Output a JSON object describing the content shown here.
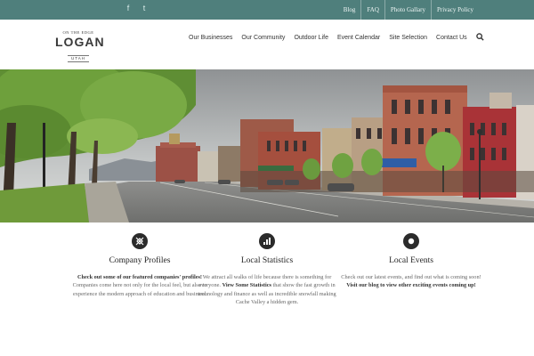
{
  "topbar": {
    "background": "#4f7f7c",
    "social": [
      {
        "icon": "facebook-icon",
        "glyph": "f"
      },
      {
        "icon": "twitter-icon",
        "glyph": "t"
      }
    ],
    "links": [
      "Blog",
      "FAQ",
      "Photo Gallary",
      "Privacy Policy"
    ]
  },
  "header": {
    "logo": {
      "tagline": "ON THE EDGE",
      "name": "LOGAN",
      "state": "UTAH"
    },
    "nav": [
      "Our Businesses",
      "Our Community",
      "Outdoor Life",
      "Event Calendar",
      "Site Selection",
      "Contact Us"
    ],
    "search_icon": "search-icon"
  },
  "hero": {
    "description_icon": "street-photo"
  },
  "features": [
    {
      "icon": "compass-icon",
      "title": "Company Profiles",
      "text_parts": [
        {
          "t": "Check out some of our featured companies' profiles!",
          "bold": true
        },
        {
          "t": " Companies come here not only for the local feel, but also to experience the modern approach of education and business.",
          "bold": false
        }
      ]
    },
    {
      "icon": "bar-chart-icon",
      "title": "Local Statistics",
      "text_parts": [
        {
          "t": "We attract all walks of life because there is something for everyone. ",
          "bold": false
        },
        {
          "t": "View Some Statistics",
          "bold": true
        },
        {
          "t": " that show the fast growth in technology and finance as well as incredible snowfall making Cache Valley a hidden gem.",
          "bold": false
        }
      ]
    },
    {
      "icon": "circle-icon",
      "title": "Local Events",
      "text_parts": [
        {
          "t": "Check out our latest events, and find out what is coming soon!  ",
          "bold": false
        },
        {
          "t": "Visit our blog to view other exciting events coming up!",
          "bold": true
        }
      ]
    }
  ]
}
